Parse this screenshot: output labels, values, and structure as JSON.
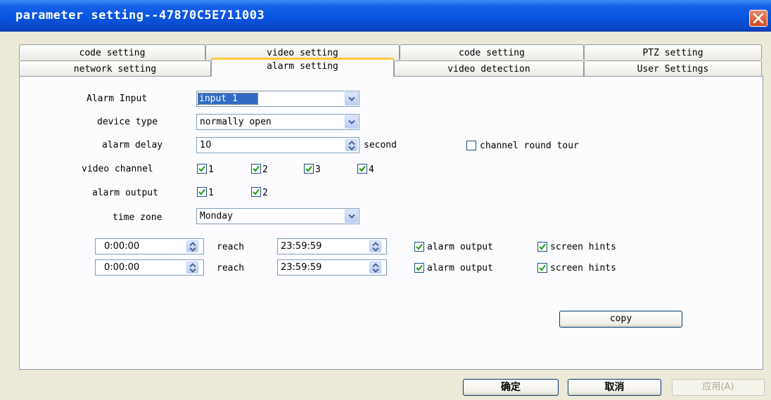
{
  "window": {
    "title": "parameter setting--47870C5E711003"
  },
  "tabs": {
    "row1": [
      "code setting",
      "video setting",
      "code setting",
      "PTZ setting"
    ],
    "row2": [
      "network setting",
      "alarm setting",
      "video detection",
      "User Settings"
    ],
    "active": "alarm setting"
  },
  "form": {
    "alarm_input": {
      "label": "Alarm Input",
      "value": "input 1"
    },
    "device_type": {
      "label": "device type",
      "value": "normally open"
    },
    "alarm_delay": {
      "label": "alarm delay",
      "value": "10",
      "unit": "second"
    },
    "channel_round_tour": {
      "label": "channel round tour",
      "checked": false
    },
    "video_channel": {
      "label": "video channel",
      "options": [
        {
          "label": "1",
          "checked": true
        },
        {
          "label": "2",
          "checked": true
        },
        {
          "label": "3",
          "checked": true
        },
        {
          "label": "4",
          "checked": true
        }
      ]
    },
    "alarm_output": {
      "label": "alarm output",
      "options": [
        {
          "label": "1",
          "checked": true
        },
        {
          "label": "2",
          "checked": true
        }
      ]
    },
    "time_zone": {
      "label": "time zone",
      "value": "Monday"
    }
  },
  "schedules": [
    {
      "start": "0:00:00",
      "reach_label": "reach",
      "end": "23:59:59",
      "alarm_output_label": "alarm output",
      "alarm_output": true,
      "screen_hints_label": "screen hints",
      "screen_hints": true
    },
    {
      "start": "0:00:00",
      "reach_label": "reach",
      "end": "23:59:59",
      "alarm_output_label": "alarm output",
      "alarm_output": true,
      "screen_hints_label": "screen hints",
      "screen_hints": true
    }
  ],
  "buttons": {
    "copy": "copy",
    "ok": "确定",
    "cancel": "取消",
    "apply": "应用(A)"
  },
  "colors": {
    "titlebar": "#0a55e0",
    "active_tab_accent": "#ffc83c",
    "check": "#21a121",
    "selection": "#316ac5"
  }
}
